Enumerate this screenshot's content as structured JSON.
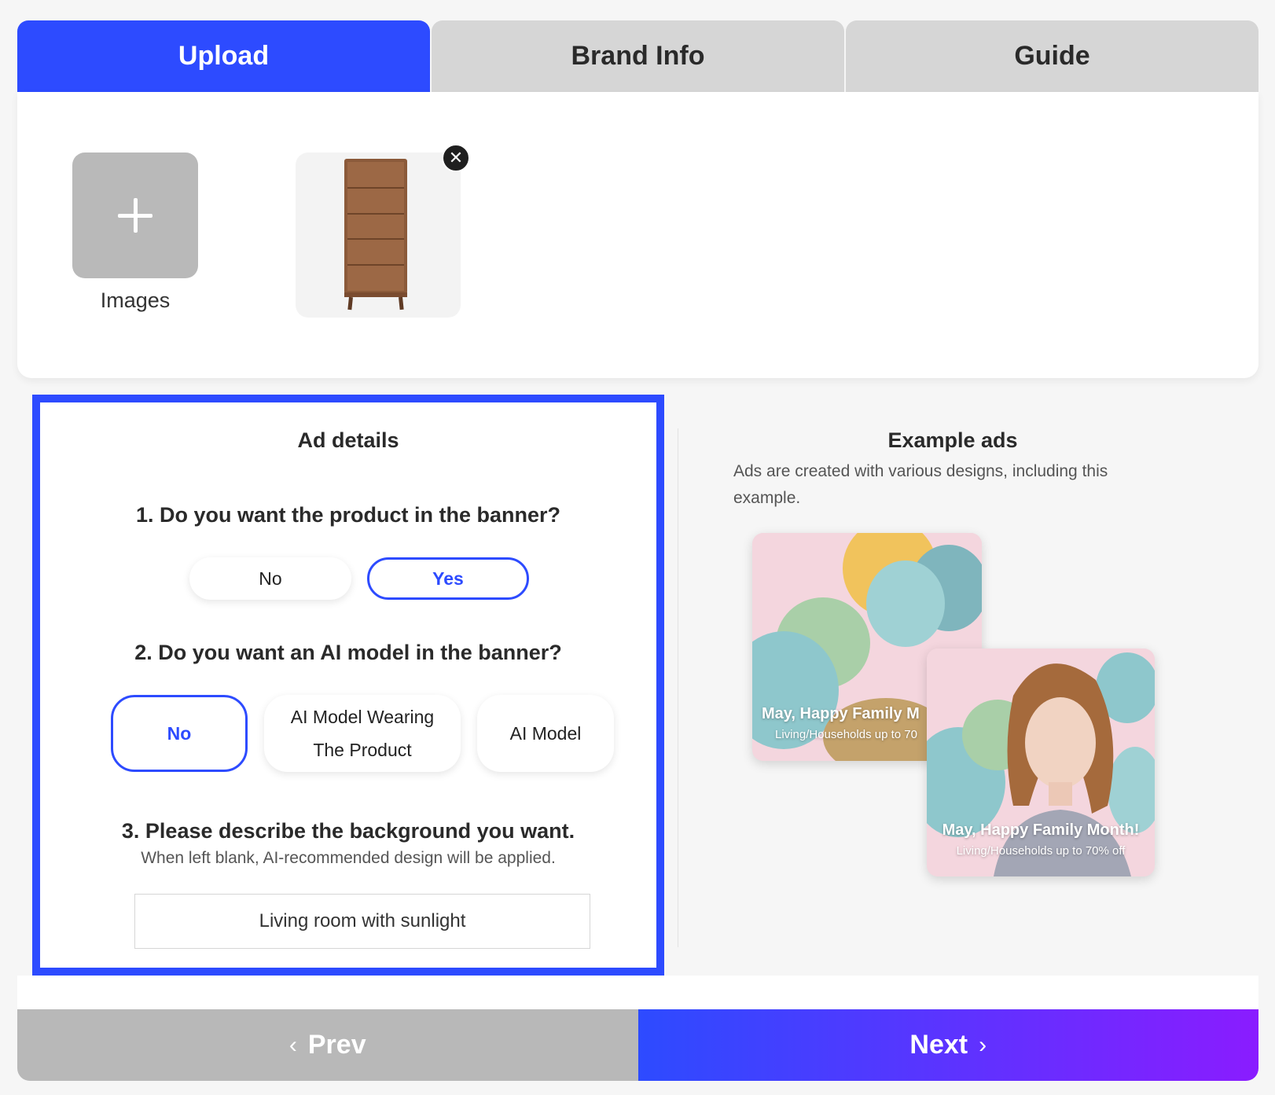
{
  "tabs": [
    {
      "label": "Upload",
      "active": true
    },
    {
      "label": "Brand Info",
      "active": false
    },
    {
      "label": "Guide",
      "active": false
    }
  ],
  "upload": {
    "add_label": "Images",
    "add_icon": "plus-icon",
    "remove_icon": "close-icon",
    "remove_glyph": "✕"
  },
  "details": {
    "title": "Ad details",
    "q1": {
      "text": "1. Do you want the product in the banner?",
      "options": [
        "No",
        "Yes"
      ],
      "selected": "Yes"
    },
    "q2": {
      "text": "2. Do you want an AI model in the banner?",
      "options": [
        "No",
        "AI Model Wearing The Product",
        "AI Model"
      ],
      "option2_line1": "AI Model Wearing",
      "option2_line2": "The Product",
      "selected": "No"
    },
    "q3": {
      "text": "3. Please describe the background you want.",
      "hint": "When left blank, AI-recommended design will be applied.",
      "value": "Living room with sunlight"
    }
  },
  "examples": {
    "title": "Example ads",
    "description": "Ads are created with various designs, including this example.",
    "card1": {
      "headline": "May, Happy Family M",
      "sub": "Living/Households up to 70"
    },
    "card2": {
      "headline": "May, Happy Family Month!",
      "sub": "Living/Households up to 70% off"
    }
  },
  "nav": {
    "prev_label": "Prev",
    "next_label": "Next",
    "prev_icon": "chevron-left-icon",
    "next_icon": "chevron-right-icon"
  },
  "colors": {
    "accent": "#2d4bff",
    "gradient_end": "#8a1cff",
    "tab_inactive": "#d6d6d6",
    "prev_bg": "#b8b8b8"
  }
}
